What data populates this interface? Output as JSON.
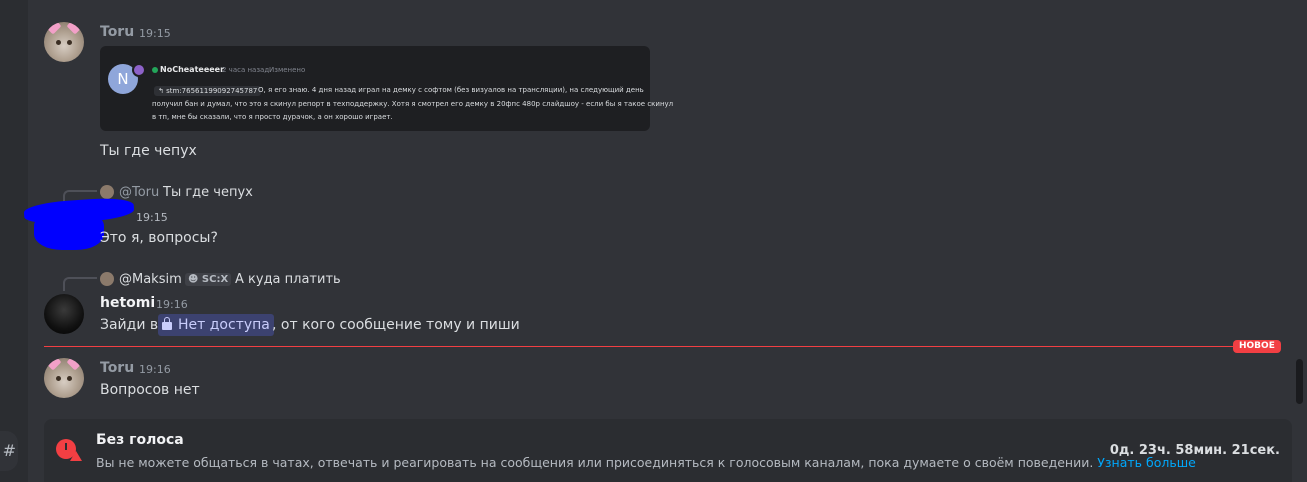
{
  "server_button_glyph": "#",
  "messages": [
    {
      "username": "Toru",
      "time": "19:15",
      "embed": {
        "avatar_letter": "N",
        "author": "NoCheateeeer",
        "time_ago": "2 часа назад",
        "edited": "Изменено",
        "tag": "stm:76561199092745787",
        "line1": "О, я его знаю. 4 дня назад играл на демку с софтом (без визуалов на трансляции), на следующий день",
        "line2": "получил бан и думал, что это я скинул репорт в техподдержку. Хотя я смотрел его демку в 20фпс 480р слайдшоу - если бы я такое скинул",
        "line3": "в тп, мне бы сказали, что я просто дурачок, а он хорошо играет."
      },
      "text": "Ты где чепух"
    },
    {
      "reply": {
        "name": "@Toru",
        "text": "Ты где чепух"
      },
      "time": "19:15",
      "text": "Это я, вопросы?"
    },
    {
      "reply": {
        "name": "@Maksim",
        "tag": "SC:X",
        "text": "А куда платить"
      },
      "username": "hetomi",
      "time": "19:16",
      "text_before": "Зайди в",
      "mention": "Нет доступа",
      "text_after": ", от кого сообщение тому и пиши"
    },
    {
      "username": "Toru",
      "time": "19:16",
      "text": "Вопросов нет"
    }
  ],
  "new_badge": "НОВОЕ",
  "timeout": {
    "title": "Без голоса",
    "description": "Вы не можете общаться в чатах, отвечать и реагировать на сообщения или присоединяться к голосовым каналам, пока думаете о своём поведении.",
    "link": "Узнать больше",
    "timer": "0д. 23ч. 58мин. 21сек."
  },
  "colors": {
    "background": "#313338",
    "new_divider": "#f23f43",
    "mention_bg": "#3c4270",
    "link": "#00a8fc"
  }
}
